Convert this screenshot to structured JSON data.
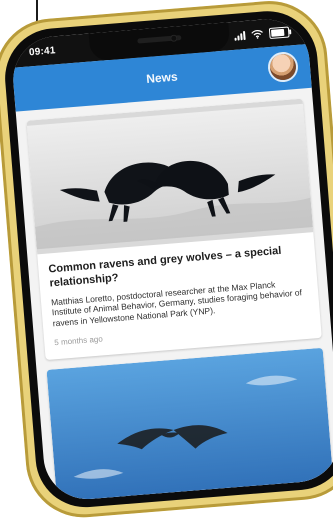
{
  "status_bar": {
    "time": "09:41"
  },
  "app_bar": {
    "title": "News"
  },
  "feed": {
    "articles": [
      {
        "headline": "Common ravens and grey wolves – a special relationship?",
        "excerpt": "Matthias Loretto, postdoctoral researcher at the Max Planck Institute of Animal Behavior, Germany, studies foraging behavior of ravens in Yellowstone National Park (YNP).",
        "time_ago": "5 months ago"
      }
    ]
  },
  "colors": {
    "accent_blue": "#2e86d6",
    "phone_gold": "#e9d27a",
    "status_black": "#111111",
    "card_bg": "#ffffff",
    "meta_gray": "#9b9b9b"
  },
  "icons": {
    "signal": "signal-icon",
    "wifi": "wifi-icon",
    "battery": "battery-icon",
    "profile": "avatar"
  }
}
